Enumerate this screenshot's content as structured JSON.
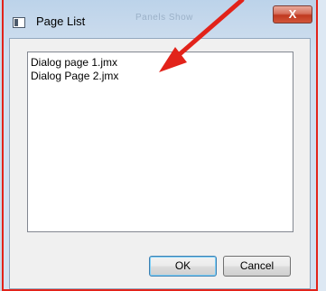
{
  "window": {
    "title": "Page List",
    "ghost_text": "Panels   Show",
    "close_label": "X"
  },
  "list": {
    "items": [
      "Dialog page 1.jmx",
      "Dialog Page 2.jmx"
    ]
  },
  "buttons": {
    "ok_label": "OK",
    "cancel_label": "Cancel"
  },
  "colors": {
    "frame_border": "#e2231a",
    "annotation_arrow": "#e2231a",
    "close_button": "#c0391f"
  }
}
